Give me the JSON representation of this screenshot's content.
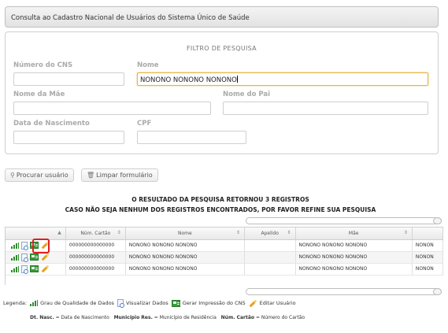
{
  "page_title": "Consulta ao Cadastro Nacional de Usuários do Sistema Único de Saúde",
  "filter": {
    "title": "FILTRO DE PESQUISA",
    "cns_label": "Número do CNS",
    "cns_value": "",
    "nome_label": "Nome",
    "nome_value": "NONONO NONONO NONONO",
    "mae_label": "Nome da Mãe",
    "mae_value": "",
    "pai_label": "Nome do Pai",
    "pai_value": "",
    "nasc_label": "Data de Nascimento",
    "nasc_value": "",
    "cpf_label": "CPF",
    "cpf_value": ""
  },
  "buttons": {
    "search_label": "Procurar usuário",
    "clear_label": "Limpar formulário",
    "search_icon": "magnifier-icon",
    "clear_icon": "trash-icon"
  },
  "result": {
    "line1": "O RESULTADO DA PESQUISA RETORNOU 3 REGISTROS",
    "line2": "CASO NÃO SEJA NENHUM DOS REGISTROS ENCONTRADOS, POR FAVOR REFINE SUA PESQUISA"
  },
  "grid": {
    "columns": [
      "",
      "Núm. Cartão",
      "Nome",
      "Apelido",
      "Mãe",
      ""
    ],
    "sort_glyph": "⇕",
    "up_glyph": "▲",
    "rows": [
      {
        "cartao": "000000000000000",
        "nome": "NONONO NONONO NONONO",
        "apelido": "",
        "mae": "NONONO NONONO NONONO",
        "extra": "NONON"
      },
      {
        "cartao": "000000000000000",
        "nome": "NONONO NONONO NONONO",
        "apelido": "",
        "mae": "NONONO NONONO NONONO",
        "extra": "NONON"
      },
      {
        "cartao": "000000000000000",
        "nome": "NONONO NONONO NONONO",
        "apelido": "",
        "mae": "NONONO NONONO NONONO",
        "extra": "NONON"
      }
    ]
  },
  "legend": {
    "prefix": "Legenda:",
    "quality": "Grau de Qualidade de Dados",
    "view": "Visualizar Dados",
    "print": "Gerar Impressão do CNS",
    "edit": "Editar Usuário"
  },
  "abbreviations": {
    "nasc_key": "Dt. Nasc.",
    "nasc_val": "= Data de Nascimento",
    "mun_key": "Município Res.",
    "mun_val": "= Município de Residência",
    "cartao_key": "Núm. Cartão",
    "cartao_val": "= Número do Cartão"
  },
  "colors": {
    "focus_border": "#e8b24a",
    "highlight": "#e01e1e",
    "icon_green": "#2f8d2f"
  }
}
